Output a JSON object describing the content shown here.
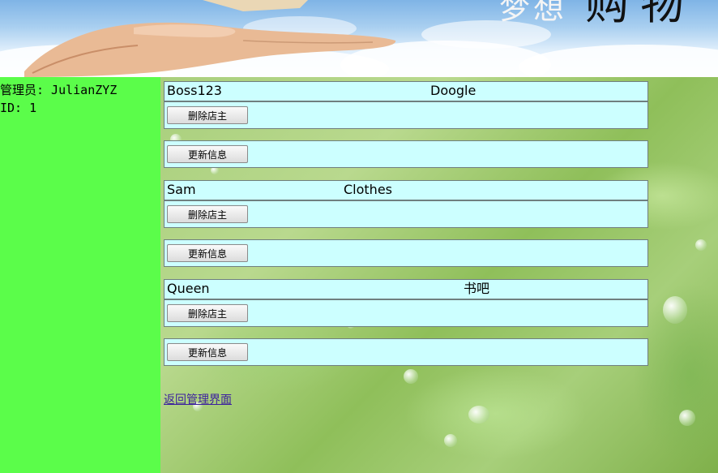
{
  "banner": {
    "title_light": "梦想",
    "title_dark": "购物"
  },
  "admin": {
    "name_line": "管理员: JulianZYZ",
    "id_line": "ID: 1"
  },
  "shops": [
    {
      "owner": "Boss123",
      "shop_name": "Doogle",
      "delete_label": "删除店主",
      "update_label": "更新信息"
    },
    {
      "owner": "Sam",
      "shop_name": "Clothes",
      "delete_label": "删除店主",
      "update_label": "更新信息"
    },
    {
      "owner": "Queen",
      "shop_name": "书吧",
      "delete_label": "删除店主",
      "update_label": "更新信息"
    }
  ],
  "back_link": "返回管理界面"
}
